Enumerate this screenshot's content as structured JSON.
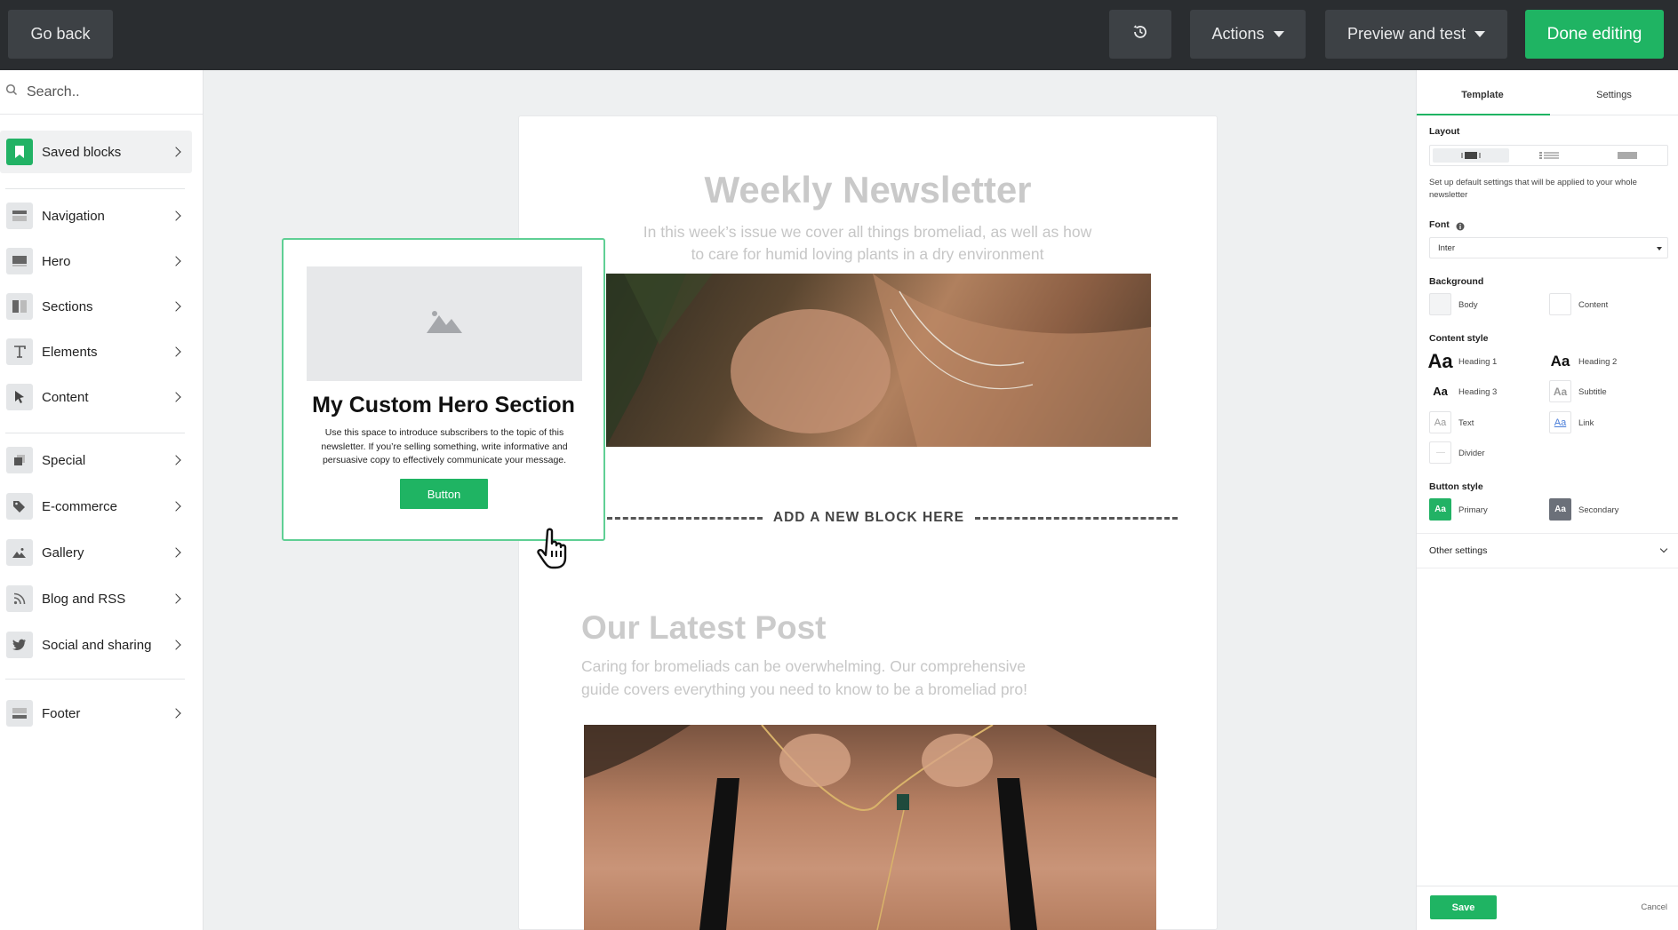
{
  "topbar": {
    "go_back": "Go back",
    "actions": "Actions",
    "preview": "Preview and test",
    "done": "Done editing",
    "history_icon": "history-icon"
  },
  "sidebar": {
    "search_placeholder": "Search..",
    "items": [
      {
        "label": "Saved blocks",
        "icon": "bookmark-icon"
      },
      {
        "label": "Navigation",
        "icon": "navigation-icon"
      },
      {
        "label": "Hero",
        "icon": "hero-icon"
      },
      {
        "label": "Sections",
        "icon": "columns-icon"
      },
      {
        "label": "Elements",
        "icon": "text-icon"
      },
      {
        "label": "Content",
        "icon": "cursor-icon"
      },
      {
        "label": "Special",
        "icon": "layers-icon"
      },
      {
        "label": "E-commerce",
        "icon": "tag-icon"
      },
      {
        "label": "Gallery",
        "icon": "image-icon"
      },
      {
        "label": "Blog and RSS",
        "icon": "rss-icon"
      },
      {
        "label": "Social and sharing",
        "icon": "twitter-icon"
      },
      {
        "label": "Footer",
        "icon": "footer-icon"
      }
    ]
  },
  "canvas": {
    "newsletter_title": "Weekly Newsletter",
    "newsletter_subtitle": "In this week’s issue we cover all things bromeliad, as well as how to care for humid loving plants in a dry environment",
    "add_block": "ADD A NEW BLOCK HERE",
    "post_title": "Our Latest Post",
    "post_subtitle": "Caring for bromeliads can be overwhelming. Our comprehensive guide covers everything you need to know to be a bromeliad pro!"
  },
  "drag_card": {
    "title": "My Custom Hero Section",
    "body": "Use this space to introduce subscribers to the topic of this newsletter. If you’re selling something, write informative and persuasive copy to effectively communicate your message.",
    "button": "Button"
  },
  "panel": {
    "tabs": [
      "Template",
      "Settings"
    ],
    "active_tab": "Template",
    "layout_label": "Layout",
    "layout_help": "Set up default settings that will be applied to your whole newsletter",
    "font_label": "Font",
    "font_value": "Inter",
    "background_label": "Background",
    "bg_body": "Body",
    "bg_content": "Content",
    "content_style_label": "Content style",
    "styles": {
      "h1": "Heading 1",
      "h2": "Heading 2",
      "h3": "Heading 3",
      "subtitle": "Subtitle",
      "text": "Text",
      "link": "Link",
      "divider": "Divider",
      "aa": "Aa"
    },
    "button_style_label": "Button style",
    "primary": "Primary",
    "secondary": "Secondary",
    "other_settings": "Other settings",
    "save": "Save",
    "cancel": "Cancel"
  },
  "colors": {
    "accent": "#1fb463",
    "topbar": "#2a2d30"
  }
}
